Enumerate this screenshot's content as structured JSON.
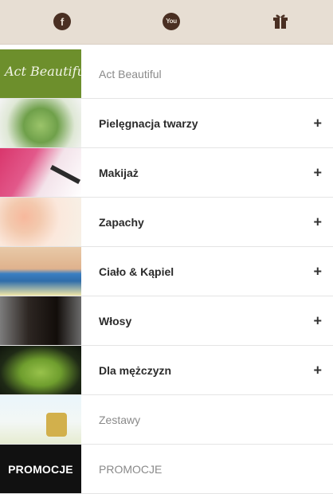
{
  "header": {
    "icons": [
      {
        "name": "facebook-icon",
        "glyph": "f"
      },
      {
        "name": "youtube-icon",
        "glyph": "You"
      },
      {
        "name": "gift-icon",
        "glyph": ""
      }
    ],
    "background": "#e7ded3",
    "icon_color": "#4a2f22"
  },
  "menu": {
    "items": [
      {
        "label": "Act Beautiful",
        "thumb_text": "Act Beautiful",
        "style": "light",
        "has_plus": false
      },
      {
        "label": "Pielęgnacja twarzy",
        "style": "bold",
        "has_plus": true,
        "plus": "+"
      },
      {
        "label": "Makijaż",
        "style": "bold",
        "has_plus": true,
        "plus": "+"
      },
      {
        "label": "Zapachy",
        "style": "bold",
        "has_plus": true,
        "plus": "+"
      },
      {
        "label": "Ciało & Kąpiel",
        "style": "bold",
        "has_plus": true,
        "plus": "+"
      },
      {
        "label": "Włosy",
        "style": "bold",
        "has_plus": true,
        "plus": "+"
      },
      {
        "label": "Dla mężczyzn",
        "style": "bold",
        "has_plus": true,
        "plus": "+"
      },
      {
        "label": "Zestawy",
        "style": "light",
        "has_plus": false
      },
      {
        "label": "PROMOCJE",
        "thumb_text": "PROMOCJE",
        "style": "light",
        "has_plus": false
      }
    ]
  }
}
